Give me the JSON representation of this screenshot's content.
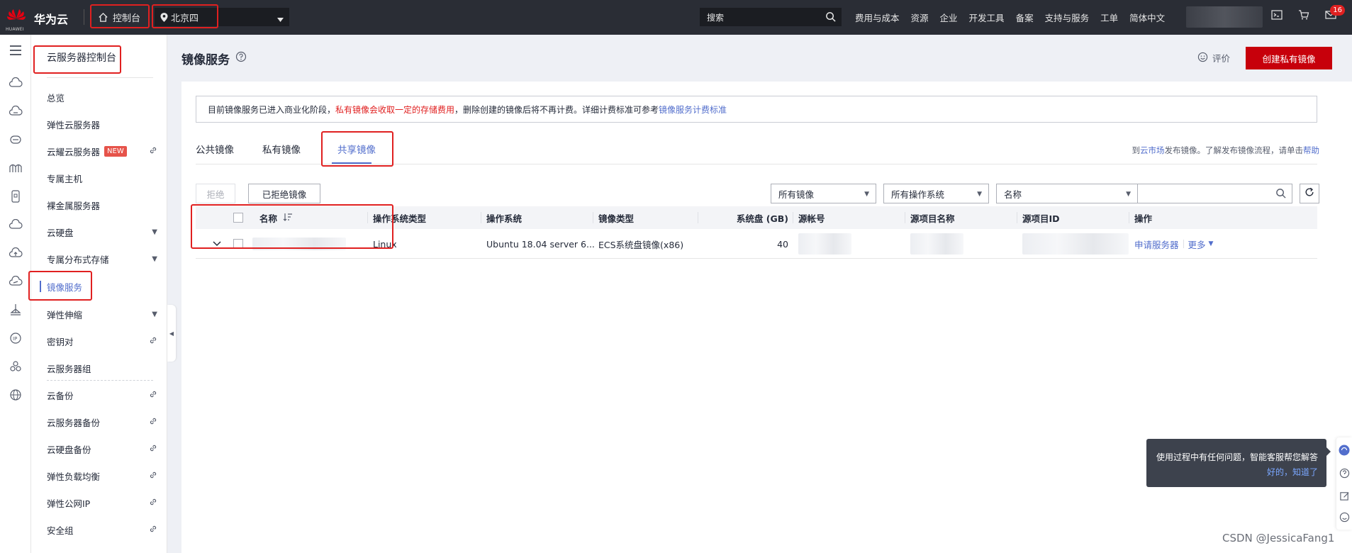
{
  "topbar": {
    "logo_text": "华为云",
    "logo_sub": "HUAWEI",
    "console_label": "控制台",
    "region": "北京四",
    "search_placeholder": "搜索",
    "nav": [
      "费用与成本",
      "资源",
      "企业",
      "开发工具",
      "备案",
      "支持与服务",
      "工单",
      "简体中文"
    ],
    "notification_count": "16"
  },
  "sidebar": {
    "title": "云服务器控制台",
    "items": [
      {
        "label": "总览",
        "right": ""
      },
      {
        "label": "弹性云服务器",
        "right": ""
      },
      {
        "label": "云耀云服务器",
        "right": "link",
        "badge": "NEW"
      },
      {
        "label": "专属主机",
        "right": ""
      },
      {
        "label": "裸金属服务器",
        "right": ""
      },
      {
        "label": "云硬盘",
        "right": "caret"
      },
      {
        "label": "专属分布式存储",
        "right": "caret"
      },
      {
        "label": "镜像服务",
        "right": "",
        "active": true
      },
      {
        "label": "弹性伸缩",
        "right": "caret"
      },
      {
        "label": "密钥对",
        "right": "link"
      },
      {
        "label": "云服务器组",
        "right": ""
      },
      {
        "label": "云备份",
        "right": "link"
      },
      {
        "label": "云服务器备份",
        "right": "link"
      },
      {
        "label": "云硬盘备份",
        "right": "link"
      },
      {
        "label": "弹性负载均衡",
        "right": "link"
      },
      {
        "label": "弹性公网IP",
        "right": "link"
      },
      {
        "label": "安全组",
        "right": "link"
      }
    ]
  },
  "header": {
    "title": "镜像服务",
    "rate_label": "评价",
    "create_button": "创建私有镜像"
  },
  "notice": {
    "part1": "目前镜像服务已进入商业化阶段，",
    "warn": "私有镜像会收取一定的存储费用",
    "part2": "，删除创建的镜像后将不再计费。详细计费标准可参考",
    "link": "镜像服务计费标准"
  },
  "tabs": [
    "公共镜像",
    "私有镜像",
    "共享镜像"
  ],
  "market_tip": {
    "pre": "到",
    "link1": "云市场",
    "mid": "发布镜像。了解发布镜像流程，请单击",
    "link2": "帮助"
  },
  "toolbar": {
    "reject_button": "拒绝",
    "rejected_button": "已拒绝镜像",
    "filter_images": "所有镜像",
    "filter_os": "所有操作系统",
    "filter_field": "名称"
  },
  "table": {
    "columns": [
      "名称",
      "操作系统类型",
      "操作系统",
      "镜像类型",
      "系统盘 (GB)",
      "源帐号",
      "源项目名称",
      "源项目ID",
      "操作"
    ],
    "rows": [
      {
        "os_type": "Linux",
        "os": "Ubuntu 18.04 server 6...",
        "image_type": "ECS系统盘镜像(x86)",
        "disk": "40",
        "op_apply": "申请服务器",
        "op_more": "更多"
      }
    ]
  },
  "help_tooltip": {
    "text": "使用过程中有任何问题，智能客服帮您解答",
    "ok": "好的，知道了"
  },
  "watermark": "CSDN @JessicaFang1",
  "colors": {
    "topbar": "#2a2d35",
    "primary": "#c7000b",
    "link": "#526ecc",
    "annotation": "#e02020"
  }
}
